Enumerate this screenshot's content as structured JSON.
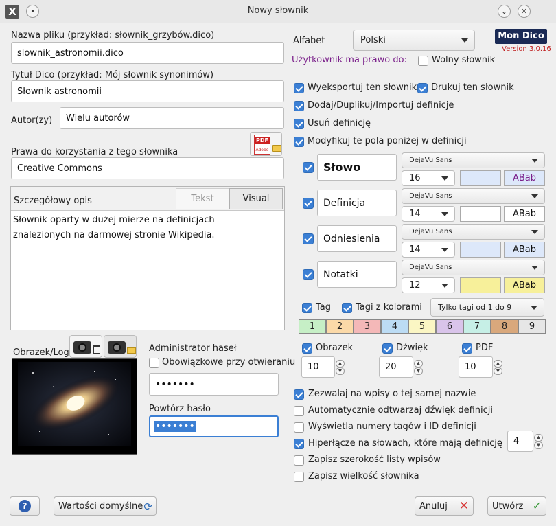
{
  "window": {
    "title": "Nowy słownik"
  },
  "file": {
    "label": "Nazwa pliku (przykład: słownik_grzybów.dico)",
    "value": "slownik_astronomii.dico"
  },
  "dico_title": {
    "label": "Tytuł Dico (przykład: Mój słownik synonimów)",
    "value": "Słownik astronomii"
  },
  "author": {
    "label": "Autor(zy)",
    "value": "Wielu autorów"
  },
  "rights": {
    "label": "Prawa do korzystania z tego słownika",
    "value": "Creative Commons"
  },
  "pdf_icon": {
    "text": "PDF",
    "sub": "Adobe"
  },
  "description": {
    "label": "Szczegółowy opis",
    "tab_text": "Tekst",
    "tab_visual": "Visual",
    "value": "Słownik oparty w dużej mierze na definicjach znalezionych na darmowej stronie Wikipedia."
  },
  "image": {
    "label": "Obrazek/Logo"
  },
  "admin": {
    "label": "Administrator haseł",
    "mandatory": {
      "label": "Obowiązkowe przy otwieraniu",
      "checked": false
    },
    "password_mask": "•••••••",
    "repeat_label": "Powtórz hasło",
    "repeat_mask": "•••••••"
  },
  "alphabet": {
    "label": "Alfabet",
    "value": "Polski"
  },
  "logo": {
    "text": "Mon Dico",
    "version": "Version 3.0.16"
  },
  "rights_user": {
    "label": "Użytkownik ma prawo do:"
  },
  "free_dict": {
    "label": "Wolny słownik",
    "checked": false
  },
  "perms": {
    "export": {
      "label": "Wyeksportuj ten słownik",
      "checked": true
    },
    "print": {
      "label": "Drukuj ten słownik",
      "checked": true
    },
    "add": {
      "label": "Dodaj/Duplikuj/Importuj definicje",
      "checked": true
    },
    "delete": {
      "label": "Usuń definicję",
      "checked": true
    },
    "modify": {
      "label": "Modyfikuj te pola poniżej w definicji",
      "checked": true
    }
  },
  "fields": [
    {
      "name": "Słowo",
      "font": "DejaVu Sans",
      "size": "16",
      "sample": "ABab",
      "bg": "#dde8fa",
      "sample_bg": "#dde8fa",
      "sample_color": "#7a1f8a",
      "bold": true,
      "checked": true
    },
    {
      "name": "Definicja",
      "font": "DejaVu Sans",
      "size": "14",
      "sample": "ABab",
      "bg": "#ffffff",
      "sample_bg": "#ffffff",
      "sample_color": "#111111",
      "bold": false,
      "checked": true
    },
    {
      "name": "Odniesienia",
      "font": "DejaVu Sans",
      "size": "14",
      "sample": "ABab",
      "bg": "#dde8fa",
      "sample_bg": "#dde8fa",
      "sample_color": "#111111",
      "bold": false,
      "checked": true
    },
    {
      "name": "Notatki",
      "font": "DejaVu Sans",
      "size": "12",
      "sample": "ABab",
      "bg": "#f7f09a",
      "sample_bg": "#f7f09a",
      "sample_color": "#111111",
      "bold": false,
      "checked": true
    }
  ],
  "tag": {
    "label": "Tag",
    "checked": true
  },
  "color_tags": {
    "label": "Tagi z kolorami",
    "checked": true
  },
  "tag_filter": {
    "value": "Tylko tagi od 1 do 9"
  },
  "tag_cells": [
    {
      "label": "1",
      "color": "#c6efc6"
    },
    {
      "label": "2",
      "color": "#fbd9a8"
    },
    {
      "label": "3",
      "color": "#f4b8b8"
    },
    {
      "label": "4",
      "color": "#bcdcf4"
    },
    {
      "label": "5",
      "color": "#fbf6c4"
    },
    {
      "label": "6",
      "color": "#d9c4ea"
    },
    {
      "label": "7",
      "color": "#c6efe6"
    },
    {
      "label": "8",
      "color": "#d9a87c"
    },
    {
      "label": "9",
      "color": "#e6e6e6"
    }
  ],
  "media": {
    "image": {
      "label": "Obrazek",
      "checked": true,
      "value": "10"
    },
    "sound": {
      "label": "Dźwięk",
      "checked": true,
      "value": "20"
    },
    "pdf": {
      "label": "PDF",
      "checked": true,
      "value": "10"
    }
  },
  "options": [
    {
      "label": "Zezwalaj na wpisy o tej samej nazwie",
      "checked": true
    },
    {
      "label": "Automatycznie odtwarzaj dźwięk definicji",
      "checked": false
    },
    {
      "label": "Wyświetla numery tagów i ID definicji",
      "checked": false
    },
    {
      "label": "Hiperłącze na słowach, które mają definicję",
      "checked": true
    },
    {
      "label": "Zapisz szerokość listy wpisów",
      "checked": false
    },
    {
      "label": "Zapisz wielkość słownika",
      "checked": false
    }
  ],
  "hyperlink_level": "4",
  "buttons": {
    "help": "?",
    "defaults": "Wartości domyślne",
    "cancel": "Anuluj",
    "create": "Utwórz"
  }
}
